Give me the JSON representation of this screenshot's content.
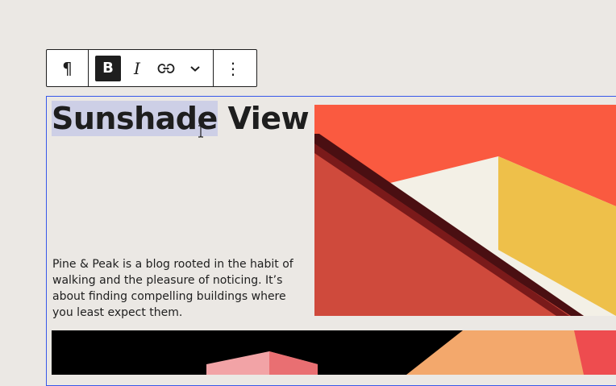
{
  "toolbar": {
    "items": [
      {
        "name": "paragraph-icon",
        "glyph": "¶"
      },
      {
        "name": "bold-icon",
        "glyph": "B",
        "active": true
      },
      {
        "name": "italic-icon",
        "glyph": "I"
      },
      {
        "name": "link-icon"
      },
      {
        "name": "chevron-down-icon"
      },
      {
        "name": "more-options-icon",
        "glyph": "⋮"
      }
    ]
  },
  "content": {
    "heading_selected": "Sunshade",
    "heading_rest": " View",
    "intro": "Pine & Peak is a blog rooted in the habit of walking and the pleasure of noticing. It’s about finding compelling buildings where you least expect them."
  },
  "colors": {
    "canvas": "#ebe8e4",
    "selection_outline": "#3858e9",
    "text_selection": "#cdcfe6",
    "image_orange": "#fa5a40",
    "image_yellow": "#eec04a"
  }
}
